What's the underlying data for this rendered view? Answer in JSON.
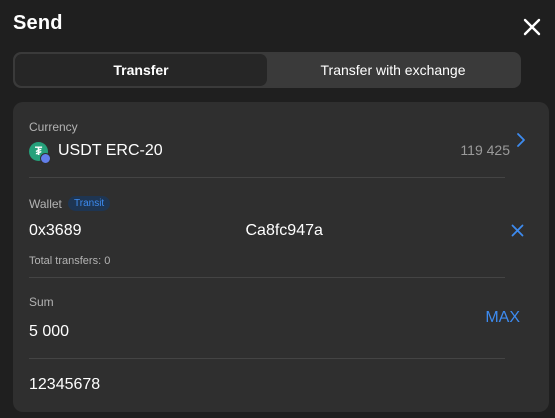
{
  "header": {
    "title": "Send",
    "close_icon": "close-icon"
  },
  "tabs": [
    {
      "label": "Transfer",
      "active": true
    },
    {
      "label": "Transfer with exchange",
      "active": false
    }
  ],
  "currency": {
    "label": "Currency",
    "name": "USDT ERC-20",
    "balance": "119 425",
    "icon": "tether-icon",
    "network_icon": "ethereum-badge-icon",
    "chevron_icon": "chevron-right-icon"
  },
  "wallet": {
    "label": "Wallet",
    "badge": "Transit",
    "address_start": "0x3689",
    "address_end": "Ca8fc947a",
    "clear_icon": "clear-icon",
    "total_transfers": "Total transfers: 0"
  },
  "sum": {
    "label": "Sum",
    "value": "5 000",
    "max_label": "MAX"
  },
  "note": {
    "value": "12345678"
  },
  "colors": {
    "background": "#1f1f1f",
    "card": "#2f2f2f",
    "accent": "#3d8bf0",
    "tether": "#26a17b"
  }
}
